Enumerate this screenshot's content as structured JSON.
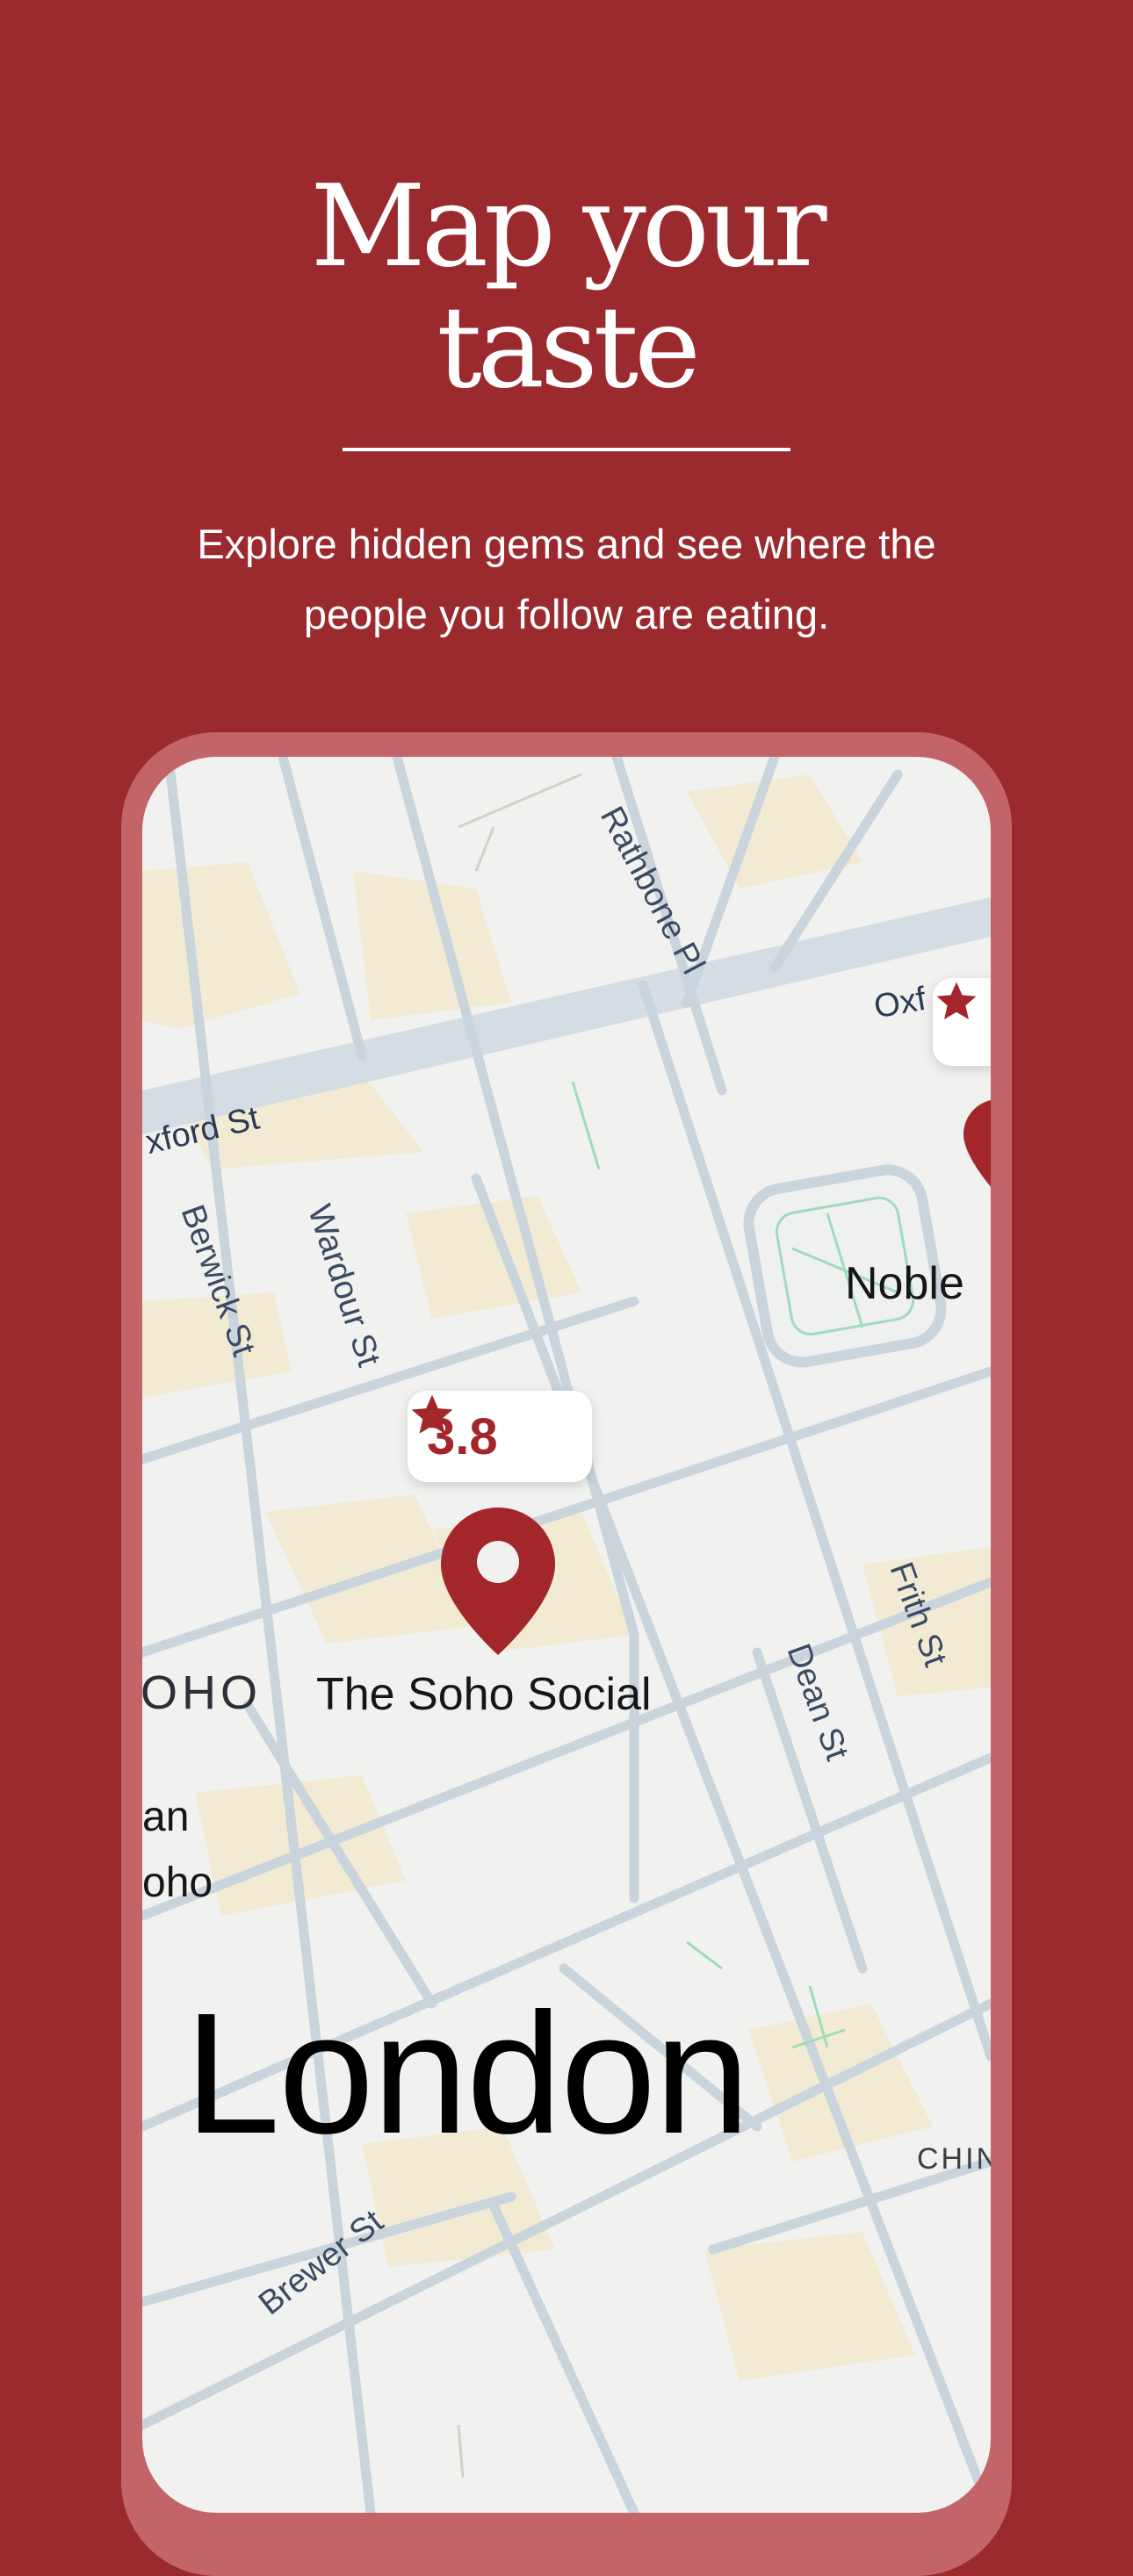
{
  "headline": {
    "line1": "Map your",
    "line2": "taste"
  },
  "subtitle": "Explore hidden gems and see where the people you follow are eating.",
  "map": {
    "city": "London",
    "streets": {
      "rathbone": "Rathbone Pl",
      "oxford_left": "xford St",
      "oxford_right": "Oxf",
      "berwick": "Berwick St",
      "wardour": "Wardour St",
      "dean": "Dean St",
      "frith": "Frith St",
      "brewer": "Brewer St"
    },
    "places": {
      "noble": "Noble",
      "soho_district": "OHO",
      "fragment_an": "an",
      "fragment_oho": "oho",
      "chinatown": "CHIN"
    },
    "restaurant": {
      "name": "The Soho Social",
      "rating": "3.8"
    },
    "colors": {
      "accent": "#9b2a2e",
      "pin": "#a3262b"
    },
    "icons": {
      "rating": "star-icon",
      "marker": "map-pin-icon"
    }
  }
}
